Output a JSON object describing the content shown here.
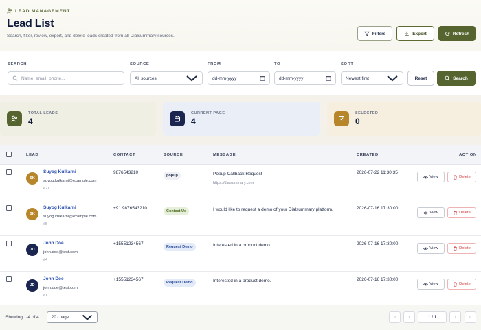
{
  "header": {
    "eyebrow": "LEAD MANAGEMENT",
    "title": "Lead List",
    "subtitle": "Search, filter, review, export, and delete leads created from all Dialsummary sources.",
    "filters_label": "Filters",
    "export_label": "Export",
    "refresh_label": "Refresh"
  },
  "filters": {
    "search_label": "SEARCH",
    "search_placeholder": "Name, email, phone...",
    "source_label": "SOURCE",
    "source_value": "All sources",
    "from_label": "FROM",
    "from_value": "dd-mm-yyyy",
    "to_label": "TO",
    "to_value": "dd-mm-yyyy",
    "sort_label": "SORT",
    "sort_value": "Newest first",
    "reset_label": "Reset",
    "search_button": "Search"
  },
  "stats": [
    {
      "label": "TOTAL LEADS",
      "value": "4",
      "color": "#56652f",
      "icon": "users-icon"
    },
    {
      "label": "CURRENT PAGE",
      "value": "4",
      "color": "#1a2550",
      "icon": "calendar-icon"
    },
    {
      "label": "SELECTED",
      "value": "0",
      "color": "#b8862a",
      "icon": "checkbox-icon"
    }
  ],
  "table": {
    "headers": {
      "lead": "LEAD",
      "contact": "CONTACT",
      "source": "SOURCE",
      "message": "MESSAGE",
      "created": "CREATED",
      "action": "ACTION"
    },
    "view_label": "View",
    "delete_label": "Delete",
    "rows": [
      {
        "initials": "SK",
        "avatar_color": "#b8862a",
        "name": "Suyog Kulkarni",
        "email": "suyog.kulkarni@example.com",
        "id": "#21",
        "contact": "9876543210",
        "source": "popup",
        "message": "Popup Callback Request",
        "message_sub": "https://dialsummary.com",
        "created": "2026-07-22 11:30:35"
      },
      {
        "initials": "SK",
        "avatar_color": "#b8862a",
        "name": "Suyog Kulkarni",
        "email": "suyog.kulkarni@example.com",
        "id": "#5",
        "contact": "+91 9876543210",
        "source": "Contact Us",
        "message": "I would like to request a demo of your Dialsummary platform.",
        "message_sub": "",
        "created": "2026-07-16 17:30:00"
      },
      {
        "initials": "JD",
        "avatar_color": "#1a2550",
        "name": "John Doe",
        "email": "john.doe@test.com",
        "id": "#4",
        "contact": "+15551234567",
        "source": "Request Demo",
        "message": "Interested in a product demo.",
        "message_sub": "",
        "created": "2026-07-16 17:30:00"
      },
      {
        "initials": "JD",
        "avatar_color": "#1a2550",
        "name": "John Doe",
        "email": "john.doe@test.com",
        "id": "#1",
        "contact": "+15551234567",
        "source": "Request Demo",
        "message": "Interested in a product demo.",
        "message_sub": "",
        "created": "2026-07-16 17:30:00"
      }
    ]
  },
  "footer": {
    "showing": "Showing 1-4 of 4",
    "per_page": "20 / page",
    "page": "1 / 1"
  }
}
